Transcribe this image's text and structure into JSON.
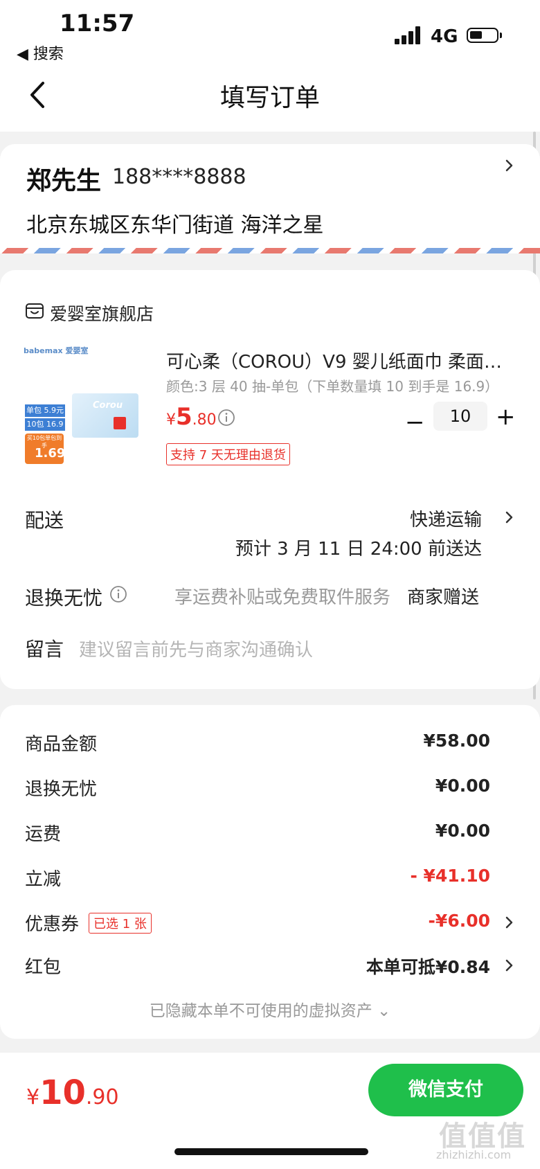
{
  "status_bar": {
    "time": "11:57",
    "back_app": "◀ 搜索",
    "network": "4G"
  },
  "nav": {
    "title": "填写订单"
  },
  "address": {
    "name": "郑先生",
    "phone": "188****8888",
    "line": "北京东城区东华门街道 海洋之星"
  },
  "store": {
    "name": "爱婴室旗舰店"
  },
  "product": {
    "title": "可心柔（COROU）V9 婴儿纸面巾 柔面…",
    "spec": "颜色:3 层 40 抽-单包（下单数量填 10 到手是 16.9）",
    "price_symbol": "¥",
    "price_int": "5",
    "price_dec": ".80",
    "quantity": "10",
    "return_tag": "支持 7 天无理由退货",
    "thumb_texts": {
      "brand": "babemax 爱婴室",
      "single": "单包 5.9元",
      "ten": "10包 16.9元",
      "note": "买10包单包到手",
      "per": "1.69"
    }
  },
  "delivery": {
    "label": "配送",
    "method": "快递运输",
    "eta": "预计 3 月 11 日 24:00 前送达"
  },
  "worry_free": {
    "label": "退换无忧",
    "desc": "享运费补贴或免费取件服务",
    "value": "商家赠送"
  },
  "message": {
    "label": "留言",
    "placeholder": "建议留言前先与商家沟通确认"
  },
  "summary": {
    "goods_label": "商品金额",
    "goods_value": "¥58.00",
    "worry_label": "退换无忧",
    "worry_value": "¥0.00",
    "shipping_label": "运费",
    "shipping_value": "¥0.00",
    "discount_label": "立减",
    "discount_value": "- ¥41.10",
    "coupon_label": "优惠券",
    "coupon_badge": "已选 1 张",
    "coupon_value": "-¥6.00",
    "redpacket_label": "红包",
    "redpacket_value": "本单可抵¥0.84",
    "hidden_note": "已隐藏本单不可使用的虚拟资产 ⌄"
  },
  "footer": {
    "total_symbol": "¥",
    "total_int": "10",
    "total_dec": ".90",
    "pay_label": "微信支付",
    "watermark": "值值值",
    "watermark_url": "zhizhizhi.com"
  },
  "colors": {
    "accent_red": "#e8302a",
    "pay_green": "#1fbf4b"
  }
}
